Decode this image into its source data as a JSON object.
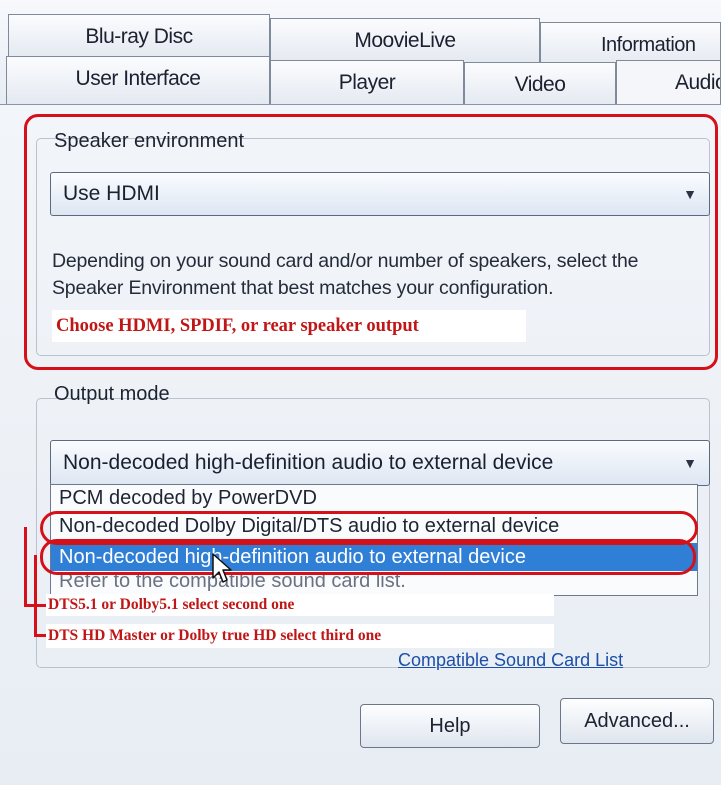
{
  "tabs": {
    "row1": [
      "Blu-ray Disc",
      "MoovieLive",
      "Information"
    ],
    "row2": [
      "User Interface",
      "Player",
      "Video",
      "Audio"
    ],
    "active": "Audio"
  },
  "speaker": {
    "title": "Speaker environment",
    "selected": "Use HDMI",
    "description": "Depending on your sound card and/or number of speakers, select the Speaker Environment that best matches your configuration.",
    "annotation": "Choose HDMI, SPDIF, or rear speaker output"
  },
  "output": {
    "title": "Output mode",
    "selected": "Non-decoded high-definition audio to external device",
    "options": [
      "PCM decoded by PowerDVD",
      "Non-decoded Dolby Digital/DTS audio to external device",
      "Non-decoded high-definition audio to external device"
    ],
    "hidden_text": "Refer to the compatible sound card list.",
    "annotation_second": "DTS5.1 or Dolby5.1 select second one",
    "annotation_third": "DTS HD Master or Dolby true HD select third one"
  },
  "links": {
    "compatible": "Compatible Sound Card List"
  },
  "buttons": {
    "help": "Help",
    "advanced": "Advanced..."
  },
  "colors": {
    "annotation_red": "#d51018",
    "selection_blue": "#2f7fd6"
  }
}
